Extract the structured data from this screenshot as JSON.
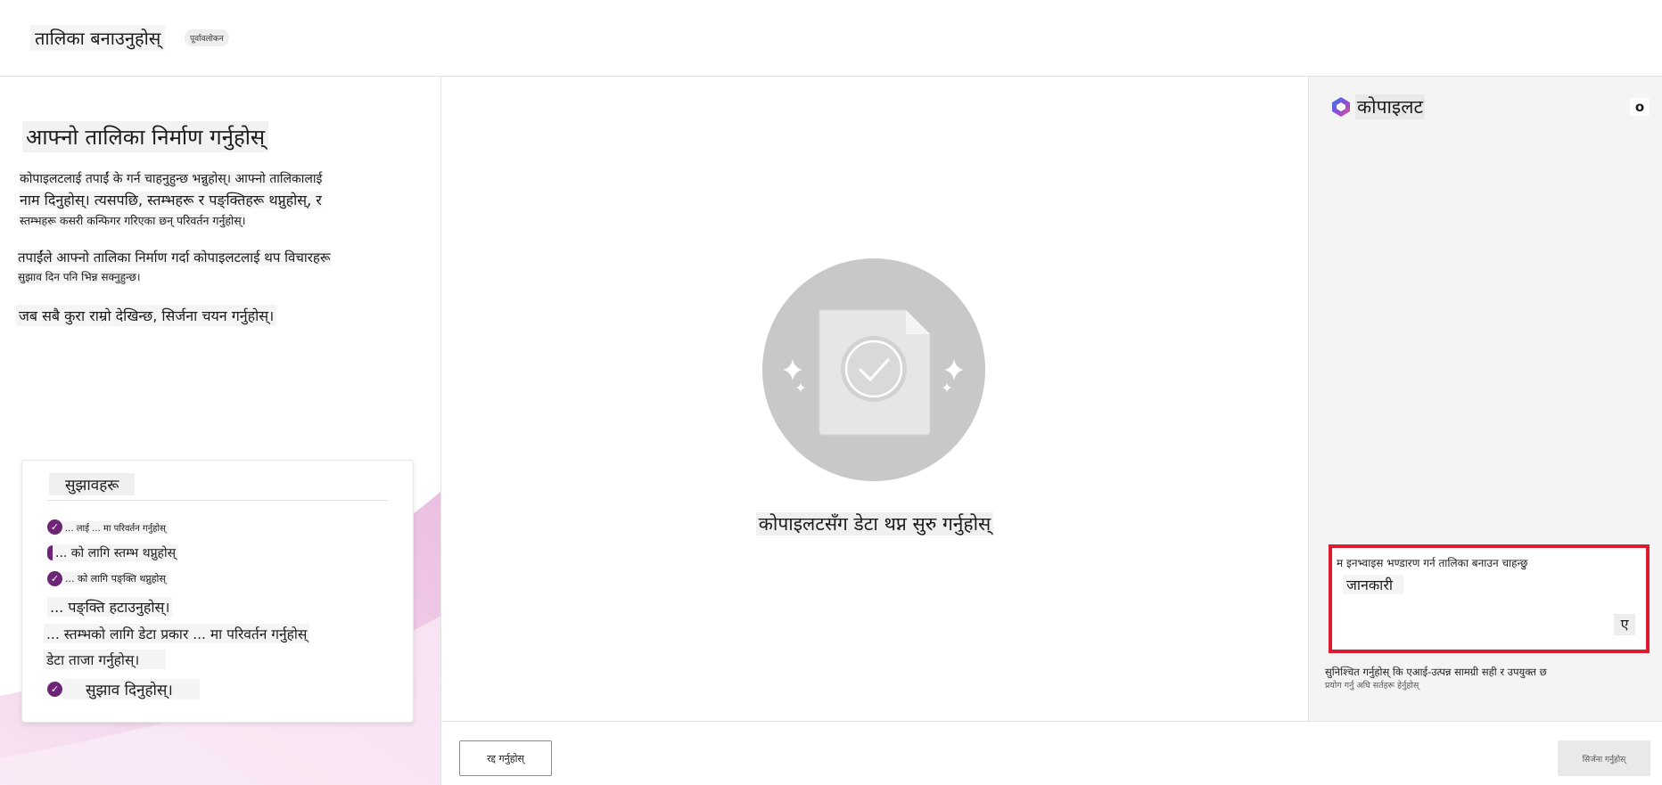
{
  "header": {
    "title": "तालिका बनाउनुहोस्",
    "badge": "पूर्वावलोकन"
  },
  "left_panel": {
    "title": "आफ्नो तालिका निर्माण गर्नुहोस्",
    "description": [
      "कोपाइलटलाई तपाईं के गर्न चाहनुहुन्छ भन्नुहोस्। आफ्नो तालिकालाई",
      "नाम दिनुहोस्। त्यसपछि, स्तम्भहरू र पङ्क्तिहरू थप्नुहोस्, र",
      "स्तम्भहरू कसरी कन्फिगर गरिएका छन् परिवर्तन गर्नुहोस्।"
    ],
    "note_line1": "तपाईंले आफ्नो तालिका निर्माण गर्दा कोपाइलटलाई थप विचारहरू",
    "note_line2": "सुझाव दिन पनि भिन्न सक्नुहुन्छ।",
    "final": "जब सबै कुरा राम्रो देखिन्छ, सिर्जना चयन गर्नुहोस्।"
  },
  "suggestions": {
    "heading": "सुझावहरू",
    "items": [
      {
        "text": "... लाई ... मा परिवर्तन गर्नुहोस्",
        "icon": "check-circle-icon"
      },
      {
        "text": "... को लागि स्तम्भ थप्नुहोस्",
        "icon": "check-circle-partial-icon"
      },
      {
        "text": "... को लागि पङ्क्ति थप्नुहोस्",
        "icon": "check-circle-icon"
      },
      {
        "text": "... पङ्क्ति हटाउनुहोस्।",
        "icon": ""
      },
      {
        "text": "... स्तम्भको लागि डेटा प्रकार ... मा परिवर्तन गर्नुहोस्",
        "icon": ""
      },
      {
        "text": "डेटा ताजा गर्नुहोस्।",
        "icon": ""
      },
      {
        "text": "सुझाव दिनुहोस्।",
        "icon": "check-circle-icon"
      }
    ]
  },
  "center": {
    "caption": "कोपाइलटसँग डेटा थप्न सुरु गर्नुहोस्"
  },
  "footer": {
    "cancel_label": "रद्द गर्नुहोस्",
    "create_label": "सिर्जना गर्नुहोस्"
  },
  "copilot": {
    "title": "कोपाइलट",
    "more_label": "o",
    "compose_text": "म इनभ्वाइस भण्डारण गर्न तालिका बनाउन चाहन्छु",
    "compose_chip": "जानकारी",
    "send_label": "ए",
    "disclaimer_line1": "सुनिश्चित गर्नुहोस् कि एआई-उत्पन्न सामग्री सही र उपयुक्त छ",
    "disclaimer_line2": "प्रयोग गर्नु अघि सर्तहरू हेर्नुहोस्",
    "accent_color": "#dc1b30"
  },
  "colors": {
    "check": "#6e2577",
    "swoosh": "#e9b5e0"
  }
}
